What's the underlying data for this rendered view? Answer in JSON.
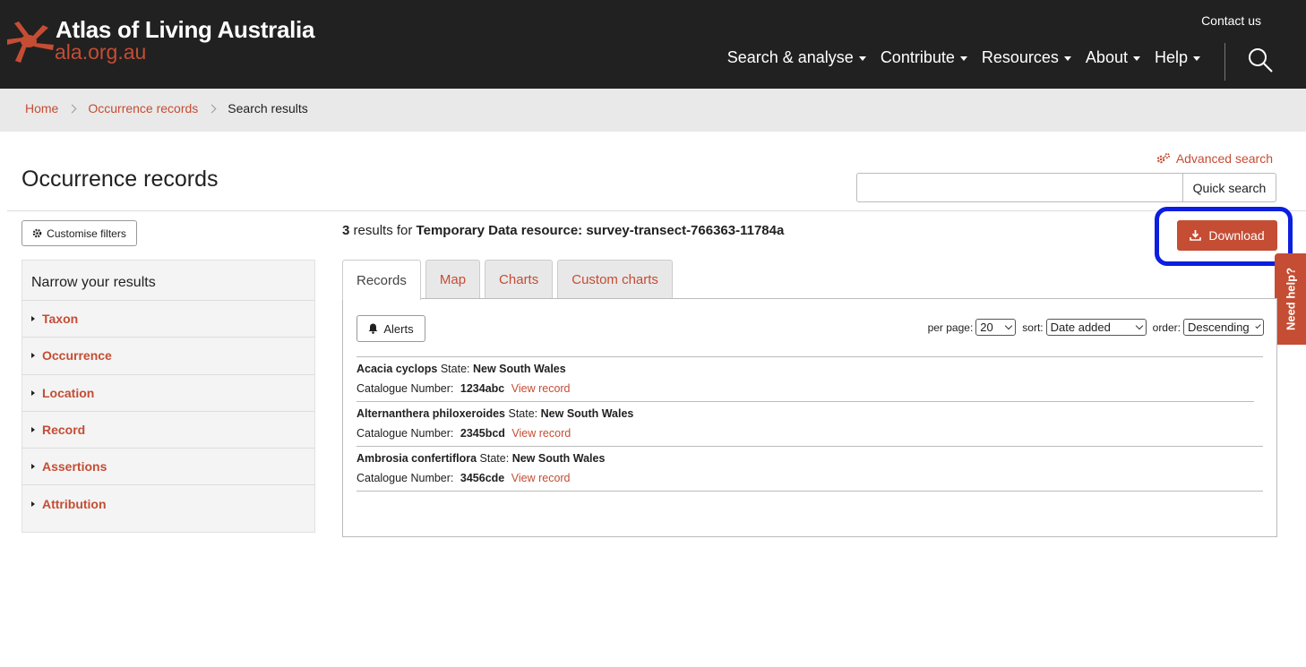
{
  "header": {
    "logo_title": "Atlas of Living Australia",
    "logo_url": "ala.org.au",
    "contact": "Contact us",
    "nav": [
      "Search & analyse",
      "Contribute",
      "Resources",
      "About",
      "Help"
    ]
  },
  "breadcrumb": {
    "home": "Home",
    "occurrence": "Occurrence records",
    "current": "Search results"
  },
  "page": {
    "title": "Occurrence records",
    "advanced_search": "Advanced search",
    "quick_search_value": "",
    "quick_search_button": "Quick search"
  },
  "sidebar": {
    "customise_label": "Customise filters",
    "heading": "Narrow your results",
    "facets": [
      "Taxon",
      "Occurrence",
      "Location",
      "Record",
      "Assertions",
      "Attribution"
    ]
  },
  "results": {
    "count": "3",
    "results_for": "results for",
    "query": "Temporary Data resource: survey-transect-766363-11784a",
    "download_label": "Download",
    "need_help": "Need help?",
    "tabs": [
      "Records",
      "Map",
      "Charts",
      "Custom charts"
    ],
    "alerts_label": "Alerts",
    "per_page_label": "per page:",
    "per_page_value": "20",
    "sort_label": "sort:",
    "sort_value": "Date added",
    "order_label": "order:",
    "order_value": "Descending",
    "records": [
      {
        "name": "Acacia cyclops",
        "state_label": "State:",
        "state": "New South Wales",
        "cat_label": "Catalogue Number:",
        "cat": "1234abc",
        "link": "View record"
      },
      {
        "name": "Alternanthera philoxeroides",
        "state_label": "State:",
        "state": "New South Wales",
        "cat_label": "Catalogue Number:",
        "cat": "2345bcd",
        "link": "View record"
      },
      {
        "name": "Ambrosia confertiflora",
        "state_label": "State:",
        "state": "New South Wales",
        "cat_label": "Catalogue Number:",
        "cat": "3456cde",
        "link": "View record"
      }
    ]
  },
  "colors": {
    "brand": "#c44d34",
    "header_bg": "#212121",
    "highlight": "#0c1ee0"
  }
}
